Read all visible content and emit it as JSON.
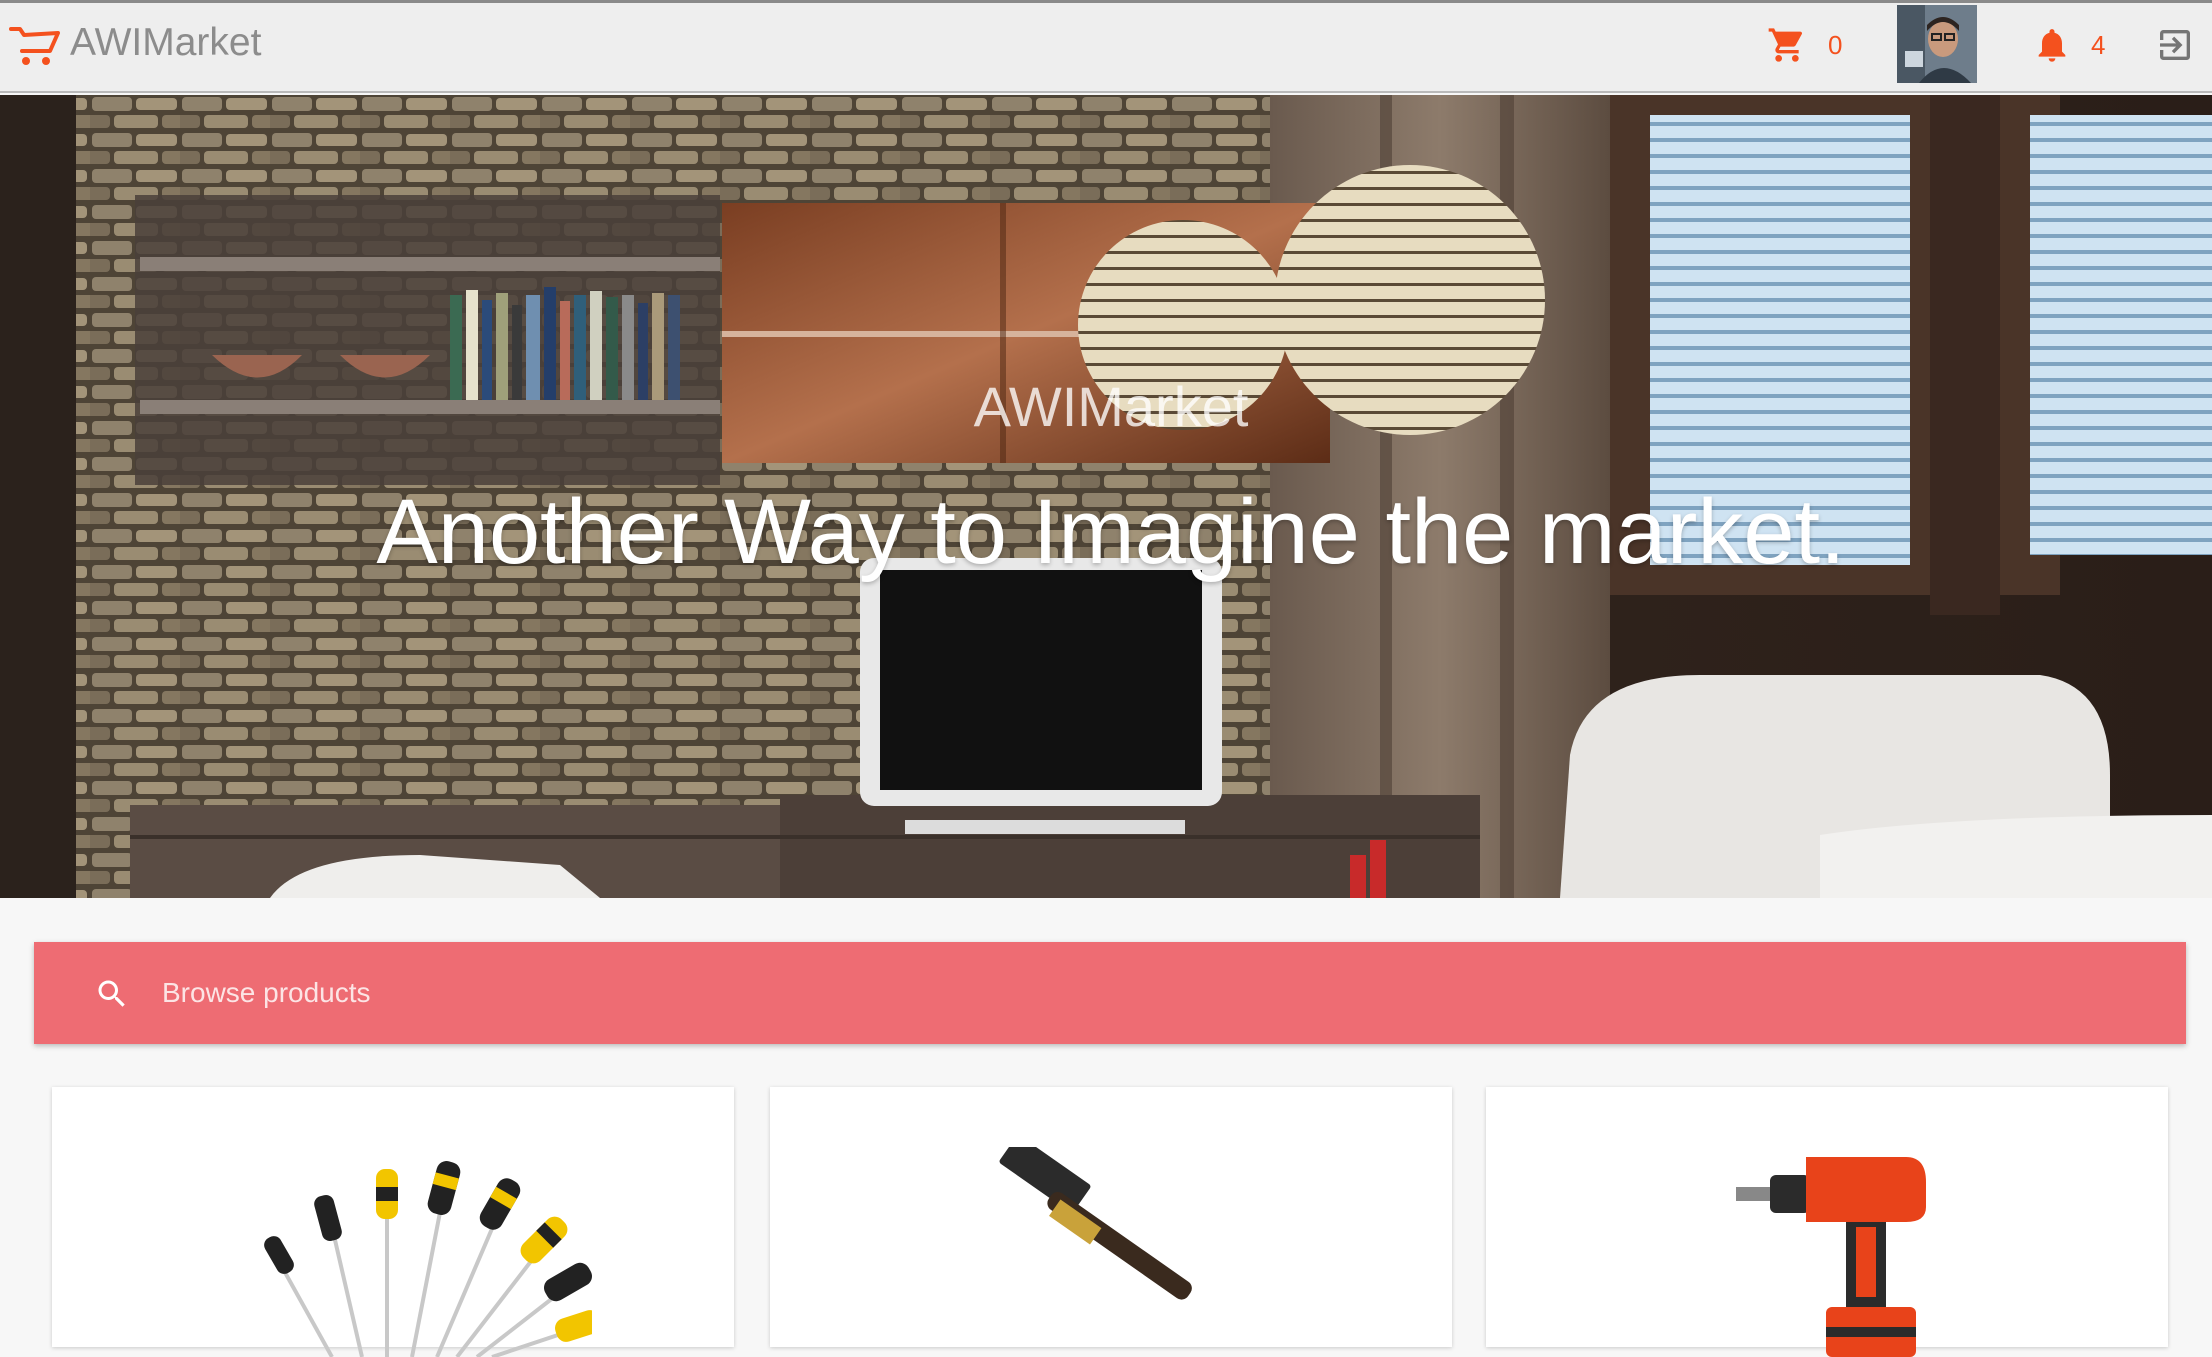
{
  "app": {
    "name": "AWIMarket",
    "accent_color": "#f4511e",
    "search_bar_color": "#ee6c73"
  },
  "toolbar": {
    "brand_icon": "shopping-cart-outline-icon",
    "cart_icon": "shopping-cart-icon",
    "cart_count": "0",
    "avatar": "user-avatar",
    "notifications_icon": "bell-icon",
    "notifications_count": "4",
    "logout_icon": "exit-to-app-icon"
  },
  "hero": {
    "brand_text": "AWIMarket",
    "tagline": "Another Way to Imagine the market."
  },
  "search": {
    "icon": "search-icon",
    "placeholder": "Browse products",
    "value": ""
  },
  "products": [
    {
      "image": "screwdriver-set"
    },
    {
      "image": "hammer"
    },
    {
      "image": "power-drill"
    }
  ]
}
